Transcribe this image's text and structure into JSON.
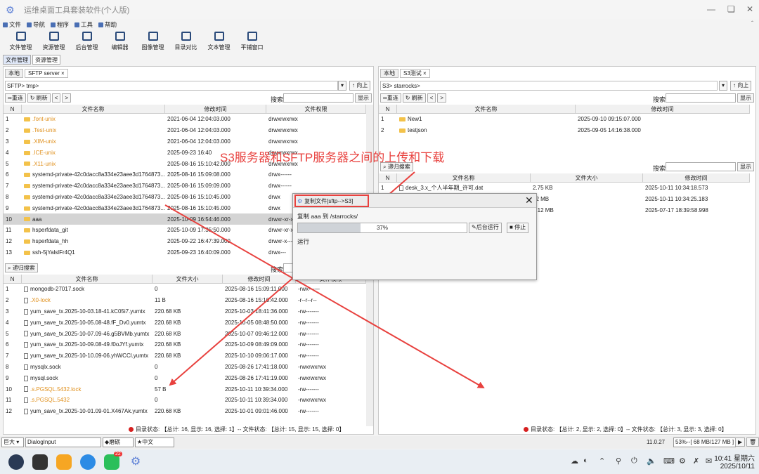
{
  "app": {
    "title": "运维桌面工具套装软件(个人版)"
  },
  "menu": [
    "文件",
    "导航",
    "程序",
    "工具",
    "帮助"
  ],
  "toolbar": [
    "文件管理",
    "资源管理",
    "后台管理",
    "编辑器",
    "图像管理",
    "目录对比",
    "文本管理",
    "平铺窗口"
  ],
  "module_tabs": [
    "文件管理",
    "资源管理"
  ],
  "left": {
    "tabs": [
      "本地",
      "SFTP server"
    ],
    "path": "SFTP> tmp>",
    "up_label": "向上",
    "refresh_button": "重连",
    "reload_button": "刷新",
    "search_label": "搜索",
    "show_button": "显示",
    "headers": [
      "N",
      "文件名称",
      "修改时间",
      "文件权限"
    ],
    "rows": [
      {
        "n": "1",
        "name": ".font-unix",
        "time": "2021-06-04 12:04:03.000",
        "perm": "drwxrwxrwx",
        "hidden": true
      },
      {
        "n": "2",
        "name": ".Test-unix",
        "time": "2021-06-04 12:04:03.000",
        "perm": "drwxrwxrwx",
        "hidden": true
      },
      {
        "n": "3",
        "name": ".XIM-unix",
        "time": "2021-06-04 12:04:03.000",
        "perm": "drwxrwxrwx",
        "hidden": true
      },
      {
        "n": "4",
        "name": ".ICE-unix",
        "time": "2025-09-23 16:40",
        "perm": "drwxrwxrwx",
        "hidden": true
      },
      {
        "n": "5",
        "name": ".X11-unix",
        "time": "2025-08-16 15:10:42.000",
        "perm": "drwxrwxrwx",
        "hidden": true
      },
      {
        "n": "6",
        "name": "systemd-private-42c0dacc8a334e23aee3d1764873...",
        "time": "2025-08-16 15:09:08.000",
        "perm": "drwx------",
        "hidden": false
      },
      {
        "n": "7",
        "name": "systemd-private-42c0dacc8a334e23aee3d1764873...",
        "time": "2025-08-16 15:09:09.000",
        "perm": "drwx------",
        "hidden": false
      },
      {
        "n": "8",
        "name": "systemd-private-42c0dacc8a334e23aee3d1764873...",
        "time": "2025-08-16 15:10:45.000",
        "perm": "drwx",
        "hidden": false
      },
      {
        "n": "9",
        "name": "systemd-private-42c0dacc8a334e23aee3d1764873...",
        "time": "2025-08-16 15:10:45.000",
        "perm": "drwx",
        "hidden": false
      },
      {
        "n": "10",
        "name": "aaa",
        "time": "2025-10-09 16:54:46.000",
        "perm": "drwxr-xr-x",
        "hidden": false
      },
      {
        "n": "11",
        "name": "hsperfdata_git",
        "time": "2025-10-09 17:35:50.000",
        "perm": "drwxr-xr-x",
        "hidden": false
      },
      {
        "n": "12",
        "name": "hsperfdata_hh",
        "time": "2025-09-22 16:47:39.000",
        "perm": "drwxr-x---",
        "hidden": false
      },
      {
        "n": "13",
        "name": "ssh-5jYalslFr4Q1",
        "time": "2025-09-23 16:40:09.000",
        "perm": "drwx---",
        "hidden": false
      }
    ],
    "search2_button": "递归搜索",
    "search2_label": "搜索",
    "headers2": [
      "N",
      "文件名称",
      "文件大小",
      "修改时间",
      "文件权限"
    ],
    "rows2": [
      {
        "n": "1",
        "name": "mongodb-27017.sock",
        "size": "0",
        "time": "2025-08-16 15:09:11.000",
        "perm": "-rwx------",
        "hidden": false
      },
      {
        "n": "2",
        "name": ".X0-lock",
        "size": "11 B",
        "time": "2025-08-16 15:10:42.000",
        "perm": "-r--r--r--",
        "hidden": true
      },
      {
        "n": "3",
        "name": "yum_save_tx.2025-10-03.18-41.kC05i7.yumtx",
        "size": "220.68 KB",
        "time": "2025-10-03 18:41:36.000",
        "perm": "-rw-------",
        "hidden": false
      },
      {
        "n": "4",
        "name": "yum_save_tx.2025-10-05.08-48.fF_Dv0.yumtx",
        "size": "220.68 KB",
        "time": "2025-10-05 08:48:50.000",
        "perm": "-rw-------",
        "hidden": false
      },
      {
        "n": "5",
        "name": "yum_save_tx.2025-10-07.09-46.g5BVMb.yumtx",
        "size": "220.68 KB",
        "time": "2025-10-07 09:46:12.000",
        "perm": "-rw-------",
        "hidden": false
      },
      {
        "n": "6",
        "name": "yum_save_tx.2025-10-09.08-49.f0oJYf.yumtx",
        "size": "220.68 KB",
        "time": "2025-10-09 08:49:09.000",
        "perm": "-rw-------",
        "hidden": false
      },
      {
        "n": "7",
        "name": "yum_save_tx.2025-10-10.09-06.yhWCCl.yumtx",
        "size": "220.68 KB",
        "time": "2025-10-10 09:06:17.000",
        "perm": "-rw-------",
        "hidden": false
      },
      {
        "n": "8",
        "name": "mysqlx.sock",
        "size": "0",
        "time": "2025-08-26 17:41:18.000",
        "perm": "-rwxrwxrwx",
        "hidden": false
      },
      {
        "n": "9",
        "name": "mysql.sock",
        "size": "0",
        "time": "2025-08-26 17:41:19.000",
        "perm": "-rwxrwxrwx",
        "hidden": false
      },
      {
        "n": "10",
        "name": ".s.PGSQL.5432.lock",
        "size": "57 B",
        "time": "2025-10-11 10:39:34.000",
        "perm": "-rw-------",
        "hidden": true
      },
      {
        "n": "11",
        "name": ".s.PGSQL.5432",
        "size": "0",
        "time": "2025-10-11 10:39:34.000",
        "perm": "-rwxrwxrwx",
        "hidden": true
      },
      {
        "n": "12",
        "name": "yum_save_tx.2025-10-01.09-01.X467Ak.yumtx",
        "size": "220.68 KB",
        "time": "2025-10-01 09:01:46.000",
        "perm": "-rw-------",
        "hidden": false
      }
    ],
    "status": "目录状态: 【总计: 16, 显示: 16, 选择: 1】-- 文件状态: 【总计: 15, 显示: 15, 选择: 0】"
  },
  "right": {
    "tabs": [
      "本地",
      "S3测试"
    ],
    "path": "S3> starrocks>",
    "up_label": "向上",
    "refresh_button": "重连",
    "reload_button": "刷新",
    "search_label": "搜索",
    "show_button": "显示",
    "headers": [
      "N",
      "文件名称",
      "修改时间"
    ],
    "rows": [
      {
        "n": "1",
        "name": "New1",
        "time": "2025-09-10 09:15:07.000"
      },
      {
        "n": "2",
        "name": "testjson",
        "time": "2025-09-05 14:16:38.000"
      }
    ],
    "search2_button": "递归搜索",
    "search2_label": "搜索",
    "show2_button": "显示",
    "headers2": [
      "N",
      "文件名称",
      "文件大小",
      "修改时间"
    ],
    "rows2": [
      {
        "n": "1",
        "name": "desk_3.x_个人半年期_许可.dat",
        "size": "2.75 KB",
        "time": "2025-10-11 10:34:18.573"
      },
      {
        "n": "",
        "name": "",
        "size": "02 MB",
        "time": "2025-10-11 10:34:25.183"
      },
      {
        "n": "",
        "name": "",
        "size": "6.12 MB",
        "time": "2025-07-17 18:39:58.998"
      }
    ],
    "status": "目录状态: 【总计: 2, 显示: 2, 选择: 0】-- 文件状态: 【总计: 3, 显示: 3, 选择: 0】"
  },
  "annotation": "S3服务器和SFTP服务器之间的上传和下载",
  "dialog": {
    "title": "复制文件[sftp-->S3]",
    "message": "复制 aaa 到 /starrocks/",
    "progress_label": "37%",
    "progress": 0.37,
    "background_button": "后台运行",
    "stop_button": "停止",
    "state": "运行"
  },
  "bottom": {
    "font_size": "巨大",
    "font_name": "DialogInput",
    "theme": "磨砺",
    "lang": "中文",
    "version": "11.0.27",
    "memory": "53%--[ 68 MB/127 MB ]"
  },
  "taskbar": {
    "time": "10:41 星期六",
    "date": "2025/10/11",
    "badge": "22"
  },
  "colors": {
    "accent": "#4a6fb4",
    "annotation": "#e8413e",
    "folder": "#f3c24a",
    "hidden_file": "#e0901c"
  }
}
